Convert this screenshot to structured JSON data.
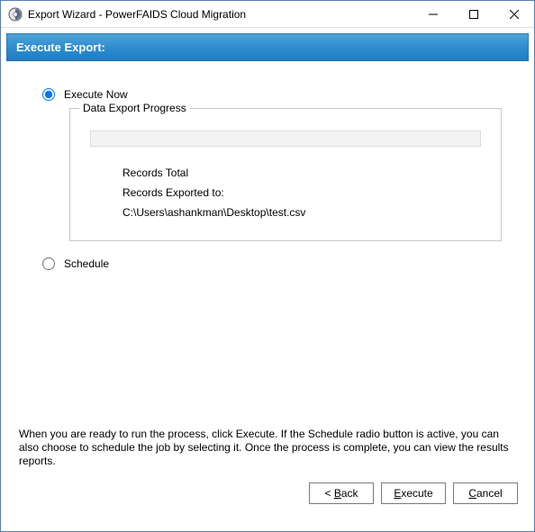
{
  "window": {
    "title": "Export Wizard - PowerFAIDS Cloud Migration"
  },
  "banner": {
    "title": "Execute Export:"
  },
  "options": {
    "execute_now": {
      "label": "Execute Now",
      "selected": true
    },
    "schedule": {
      "label": "Schedule",
      "selected": false
    }
  },
  "progress": {
    "legend": "Data Export Progress",
    "records_total_label": "Records Total",
    "records_exported_label": "Records Exported to:",
    "export_path": "C:\\Users\\ashankman\\Desktop\\test.csv"
  },
  "instructions": {
    "text": "When you are ready to run the process, click Execute.  If the Schedule radio button is active, you can also choose to schedule the job by selecting it. Once the process is complete, you can view the results reports."
  },
  "buttons": {
    "back_prefix": "< ",
    "back_u": "B",
    "back_rest": "ack",
    "execute_u": "E",
    "execute_rest": "xecute",
    "cancel_u": "C",
    "cancel_rest": "ancel"
  }
}
